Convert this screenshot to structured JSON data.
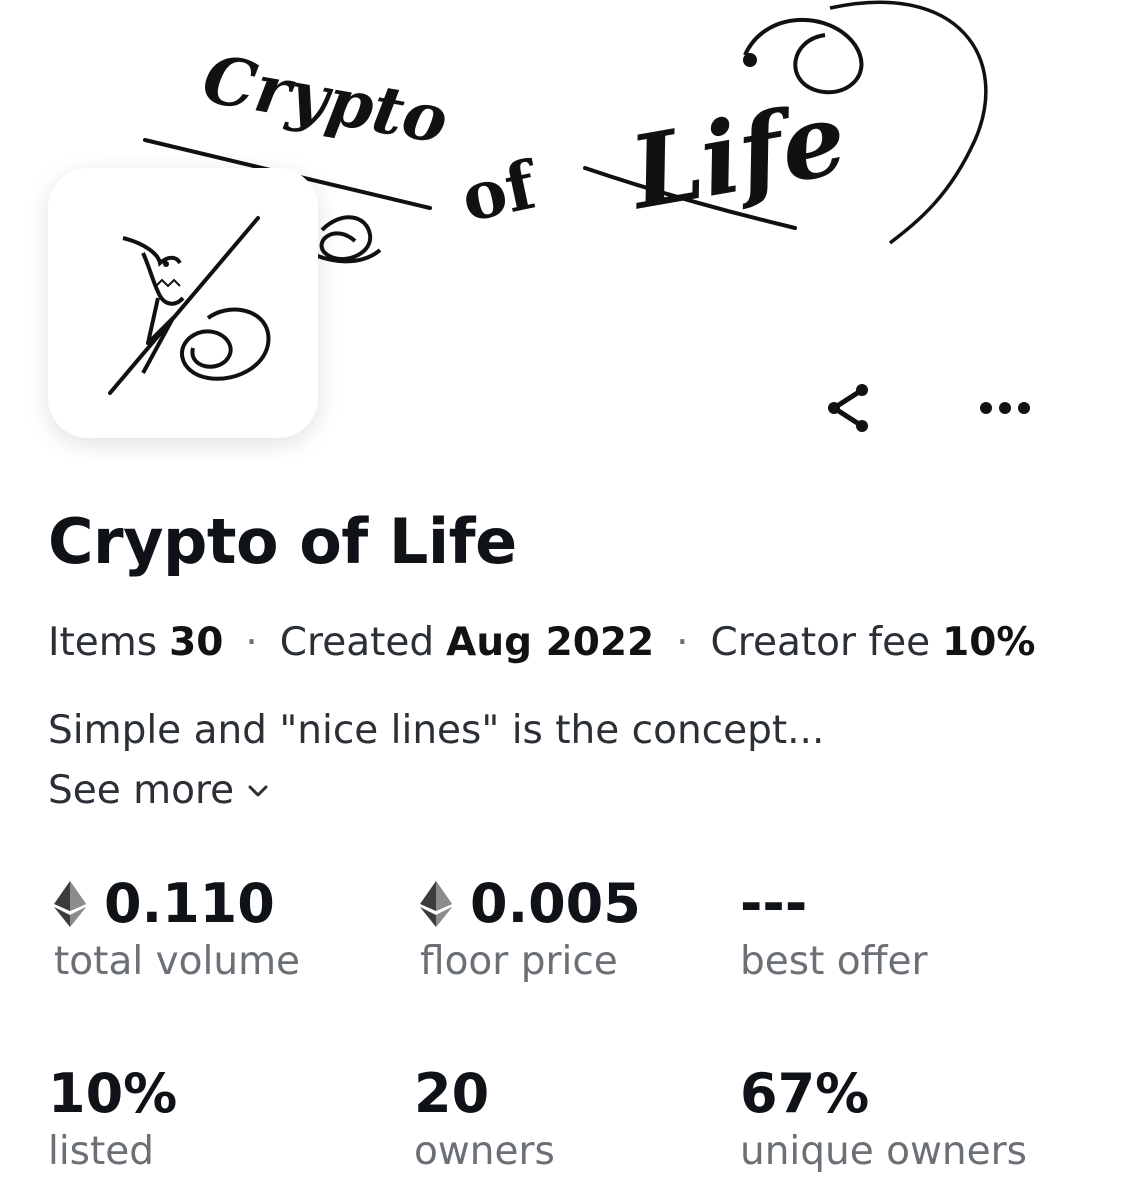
{
  "banner": {
    "artwork_text_1": "Crypto",
    "artwork_text_2": "of",
    "artwork_text_3": "Life"
  },
  "collection": {
    "title": "Crypto of Life",
    "items_label": "Items",
    "items_value": "30",
    "created_label": "Created",
    "created_value": "Aug 2022",
    "creator_fee_label": "Creator fee",
    "creator_fee_value": "10%",
    "separator": "·",
    "description": "Simple and \"nice lines\" is the concept...",
    "see_more_label": "See more"
  },
  "stats": {
    "total_volume": {
      "value": "0.110",
      "label": "total volume"
    },
    "floor_price": {
      "value": "0.005",
      "label": "floor price"
    },
    "best_offer": {
      "value": "---",
      "label": "best offer"
    },
    "listed": {
      "value": "10%",
      "label": "listed"
    },
    "owners": {
      "value": "20",
      "label": "owners"
    },
    "unique_owners": {
      "value": "67%",
      "label": "unique owners"
    }
  },
  "icons": {
    "share": "share-icon",
    "more": "more-icon",
    "eth": "ethereum-icon",
    "chevron": "chevron-down-icon"
  },
  "colors": {
    "text_primary": "#0f1217",
    "text_secondary": "#6b6f76",
    "background": "#ffffff"
  }
}
